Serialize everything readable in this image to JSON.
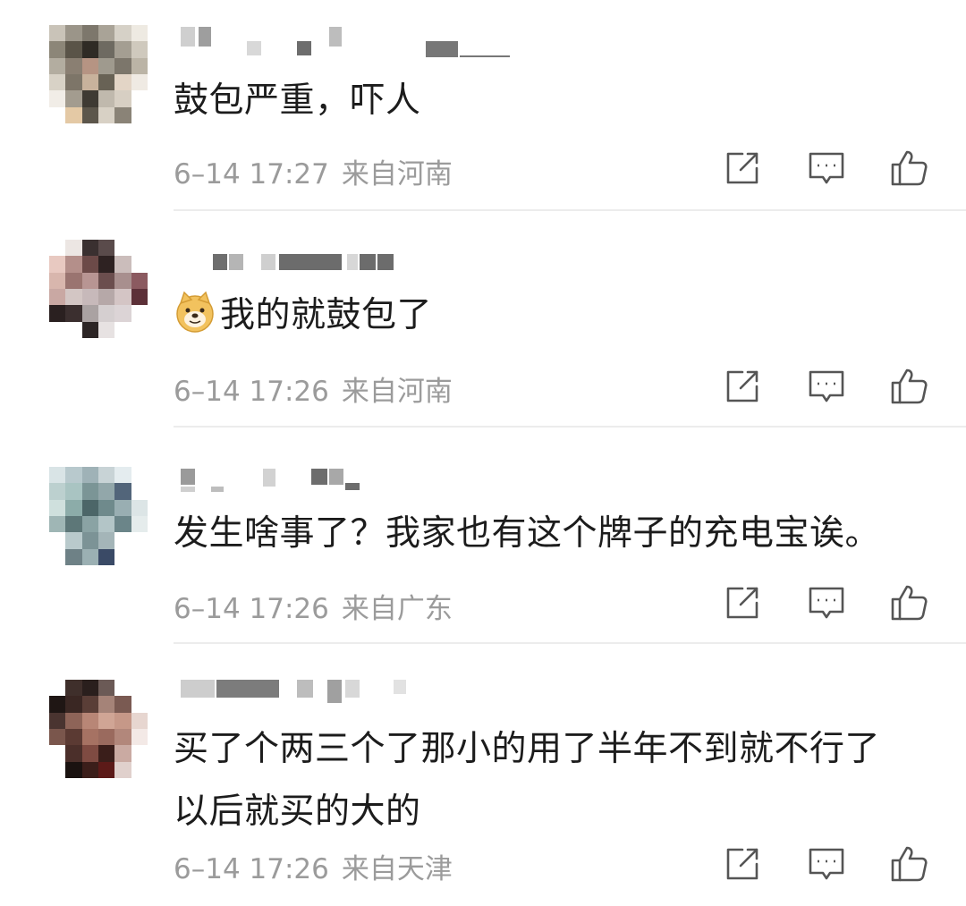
{
  "comments": [
    {
      "text": "鼓包严重，吓人",
      "date": "6–14 17:27",
      "location": "来自河南"
    },
    {
      "text": "我的就鼓包了",
      "date": "6–14 17:26",
      "location": "来自河南",
      "emoji": "doge-emoji"
    },
    {
      "text": "发生啥事了？我家也有这个牌子的充电宝诶。",
      "date": "6–14 17:26",
      "location": "来自广东"
    },
    {
      "text_lines": [
        "买了个两三个了那小的用了半年不到就不行了",
        "以后就买的大的"
      ],
      "date": "6–14 17:26",
      "location": "来自天津"
    }
  ],
  "icons": [
    "share-icon",
    "reply-icon",
    "like-icon"
  ],
  "colors": {
    "text": "#1c1c1c",
    "meta": "#9b9b9b",
    "icon": "#555555",
    "divider": "#ececec"
  }
}
